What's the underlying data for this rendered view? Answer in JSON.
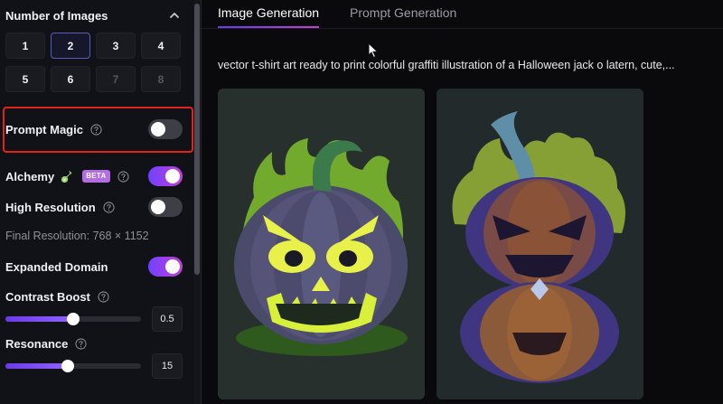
{
  "sidebar": {
    "number_of_images": {
      "title": "Number of Images",
      "options": [
        {
          "label": "1",
          "state": "normal"
        },
        {
          "label": "2",
          "state": "active"
        },
        {
          "label": "3",
          "state": "normal"
        },
        {
          "label": "4",
          "state": "normal"
        },
        {
          "label": "5",
          "state": "normal"
        },
        {
          "label": "6",
          "state": "normal"
        },
        {
          "label": "7",
          "state": "disabled"
        },
        {
          "label": "8",
          "state": "disabled"
        }
      ]
    },
    "prompt_magic": {
      "label": "Prompt Magic",
      "enabled": false,
      "highlight_color": "#e2231a"
    },
    "alchemy": {
      "label": "Alchemy",
      "badge": "BETA",
      "enabled": true,
      "icon": "flask-icon"
    },
    "high_resolution": {
      "label": "High Resolution",
      "enabled": false
    },
    "final_resolution": "Final Resolution: 768 × 1152",
    "expanded_domain": {
      "label": "Expanded Domain",
      "enabled": true
    },
    "contrast_boost": {
      "label": "Contrast Boost",
      "value": "0.5",
      "fraction": 0.5
    },
    "resonance": {
      "label": "Resonance",
      "value": "15",
      "fraction": 0.46
    }
  },
  "main": {
    "tabs": [
      {
        "label": "Image Generation",
        "active": true
      },
      {
        "label": "Prompt Generation",
        "active": false
      }
    ],
    "prompt": "vector t-shirt art ready to print colorful graffiti illustration of a Halloween jack o latern, cute,...",
    "images": [
      {
        "subject": "jack-o-lantern-image-1"
      },
      {
        "subject": "jack-o-lantern-image-2"
      }
    ]
  },
  "colors": {
    "accent_purple": "#6f42ff",
    "accent_magenta": "#c33fd8",
    "sidebar_bg": "#111217",
    "main_bg": "#0a0a0d"
  }
}
